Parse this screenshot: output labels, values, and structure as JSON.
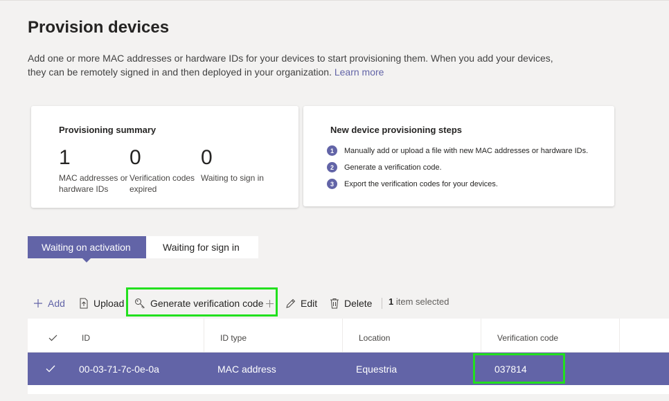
{
  "page": {
    "title": "Provision devices",
    "description": "Add one or more MAC addresses or hardware IDs for your devices to start provisioning them. When you add your devices, they can be remotely signed in and then deployed in your organization.",
    "learn_more": "Learn more"
  },
  "summary": {
    "title": "Provisioning summary",
    "stats": [
      {
        "value": "1",
        "label": "MAC addresses or hardware IDs"
      },
      {
        "value": "0",
        "label": "Verification codes expired"
      },
      {
        "value": "0",
        "label": "Waiting to sign in"
      }
    ]
  },
  "steps": {
    "title": "New device provisioning steps",
    "items": [
      {
        "num": "1",
        "text": "Manually add or upload a file with new MAC addresses or hardware IDs."
      },
      {
        "num": "2",
        "text": "Generate a verification code."
      },
      {
        "num": "3",
        "text": "Export the verification codes for your devices."
      }
    ]
  },
  "tabs": [
    {
      "label": "Waiting on activation",
      "active": true
    },
    {
      "label": "Waiting for sign in",
      "active": false
    }
  ],
  "toolbar": {
    "add": "Add",
    "upload": "Upload",
    "generate": "Generate verification code",
    "edit": "Edit",
    "delete": "Delete",
    "selected_count": "1",
    "selected_text": "item selected"
  },
  "table": {
    "columns": [
      "ID",
      "ID type",
      "Location",
      "Verification code"
    ],
    "rows": [
      {
        "id": "00-03-71-7c-0e-0a",
        "id_type": "MAC address",
        "location": "Equestria",
        "code": "037814",
        "selected": true
      }
    ]
  },
  "colors": {
    "accent": "#6264a7",
    "highlight": "#22e01e",
    "background": "#f3f2f1"
  }
}
